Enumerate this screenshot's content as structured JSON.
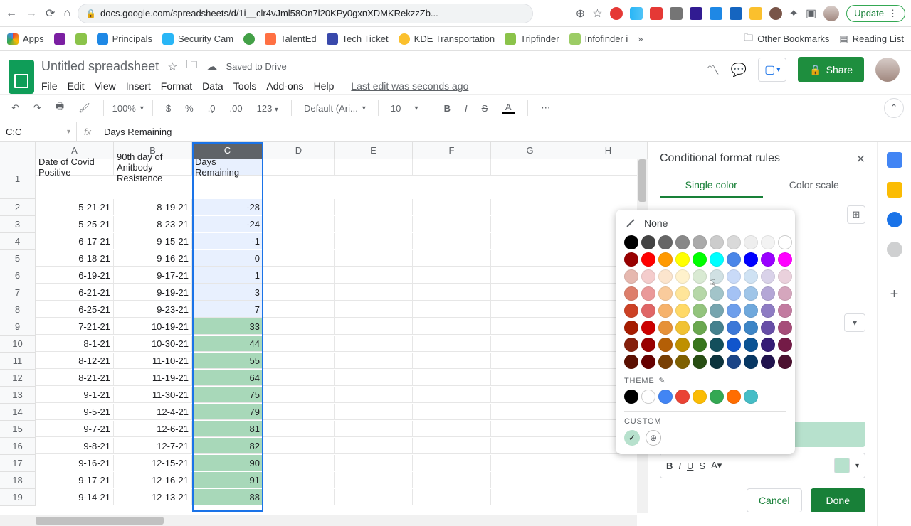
{
  "browser": {
    "url": "docs.google.com/spreadsheets/d/1i__clr4vJml58On7l20KPy0gxnXDMKRekzzZb...",
    "update": "Update",
    "bookmarks": [
      {
        "label": "Apps",
        "color": "#5f6368"
      },
      {
        "label": "",
        "color": "#7b1fa2"
      },
      {
        "label": "",
        "color": "#8bc34a"
      },
      {
        "label": "Principals",
        "color": "#1e88e5"
      },
      {
        "label": "Security Cam",
        "color": "#29b6f6"
      },
      {
        "label": "",
        "color": "#43a047"
      },
      {
        "label": "TalentEd",
        "color": "#ff7043"
      },
      {
        "label": "Tech Ticket",
        "color": "#3949ab"
      },
      {
        "label": "KDE Transportation",
        "color": "#fbc02d"
      },
      {
        "label": "Tripfinder",
        "color": "#8bc34a"
      },
      {
        "label": "Infofinder i",
        "color": "#9ccc65"
      }
    ],
    "right_bm": [
      {
        "label": "Other Bookmarks"
      },
      {
        "label": "Reading List"
      }
    ]
  },
  "docs": {
    "title": "Untitled spreadsheet",
    "saved": "Saved to Drive",
    "menus": [
      "File",
      "Edit",
      "View",
      "Insert",
      "Format",
      "Data",
      "Tools",
      "Add-ons",
      "Help"
    ],
    "last_edit": "Last edit was seconds ago",
    "share": "Share"
  },
  "toolbar": {
    "zoom": "100%",
    "font": "Default (Ari...",
    "size": "10"
  },
  "namebox": "C:C",
  "formula": "Days Remaining",
  "columns": [
    "A",
    "B",
    "C",
    "D",
    "E",
    "F",
    "G",
    "H"
  ],
  "rows": [
    {
      "n": 1,
      "a": "Date of Covid Positive",
      "b": "90th day of Anitbody Resistence",
      "c": "Days Remaining",
      "green": false,
      "header": true
    },
    {
      "n": 2,
      "a": "5-21-21",
      "b": "8-19-21",
      "c": "-28",
      "green": false
    },
    {
      "n": 3,
      "a": "5-25-21",
      "b": "8-23-21",
      "c": "-24",
      "green": false
    },
    {
      "n": 4,
      "a": "6-17-21",
      "b": "9-15-21",
      "c": "-1",
      "green": false
    },
    {
      "n": 5,
      "a": "6-18-21",
      "b": "9-16-21",
      "c": "0",
      "green": false
    },
    {
      "n": 6,
      "a": "6-19-21",
      "b": "9-17-21",
      "c": "1",
      "green": false
    },
    {
      "n": 7,
      "a": "6-21-21",
      "b": "9-19-21",
      "c": "3",
      "green": false
    },
    {
      "n": 8,
      "a": "6-25-21",
      "b": "9-23-21",
      "c": "7",
      "green": false
    },
    {
      "n": 9,
      "a": "7-21-21",
      "b": "10-19-21",
      "c": "33",
      "green": true
    },
    {
      "n": 10,
      "a": "8-1-21",
      "b": "10-30-21",
      "c": "44",
      "green": true
    },
    {
      "n": 11,
      "a": "8-12-21",
      "b": "11-10-21",
      "c": "55",
      "green": true
    },
    {
      "n": 12,
      "a": "8-21-21",
      "b": "11-19-21",
      "c": "64",
      "green": true
    },
    {
      "n": 13,
      "a": "9-1-21",
      "b": "11-30-21",
      "c": "75",
      "green": true
    },
    {
      "n": 14,
      "a": "9-5-21",
      "b": "12-4-21",
      "c": "79",
      "green": true
    },
    {
      "n": 15,
      "a": "9-7-21",
      "b": "12-6-21",
      "c": "81",
      "green": true
    },
    {
      "n": 16,
      "a": "9-8-21",
      "b": "12-7-21",
      "c": "82",
      "green": true
    },
    {
      "n": 17,
      "a": "9-16-21",
      "b": "12-15-21",
      "c": "90",
      "green": true
    },
    {
      "n": 18,
      "a": "9-17-21",
      "b": "12-16-21",
      "c": "91",
      "green": true
    },
    {
      "n": 19,
      "a": "9-14-21",
      "b": "12-13-21",
      "c": "88",
      "green": true
    }
  ],
  "pane": {
    "title": "Conditional format rules",
    "tab1": "Single color",
    "tab2": "Color scale",
    "cancel": "Cancel",
    "done": "Done"
  },
  "picker": {
    "none": "None",
    "theme": "THEME",
    "custom": "CUSTOM",
    "standard_rows": [
      [
        "#000000",
        "#434343",
        "#666666",
        "#888888",
        "#aaaaaa",
        "#cccccc",
        "#d9d9d9",
        "#eeeeee",
        "#f3f3f3",
        "#ffffff"
      ],
      [
        "#980000",
        "#ff0000",
        "#ff9900",
        "#ffff00",
        "#00ff00",
        "#00ffff",
        "#4a86e8",
        "#0000ff",
        "#9900ff",
        "#ff00ff"
      ],
      [
        "#e6b8af",
        "#f4cccc",
        "#fce5cd",
        "#fff2cc",
        "#d9ead3",
        "#d0e0e3",
        "#c9daf8",
        "#cfe2f3",
        "#d9d2e9",
        "#ead1dc"
      ],
      [
        "#dd7e6b",
        "#ea9999",
        "#f9cb9c",
        "#ffe599",
        "#b6d7a8",
        "#a2c4c9",
        "#a4c2f4",
        "#9fc5e8",
        "#b4a7d6",
        "#d5a6bd"
      ],
      [
        "#cc4125",
        "#e06666",
        "#f6b26b",
        "#ffd966",
        "#93c47d",
        "#76a5af",
        "#6d9eeb",
        "#6fa8dc",
        "#8e7cc3",
        "#c27ba0"
      ],
      [
        "#a61c00",
        "#cc0000",
        "#e69138",
        "#f1c232",
        "#6aa84f",
        "#45818e",
        "#3c78d8",
        "#3d85c6",
        "#674ea7",
        "#a64d79"
      ],
      [
        "#85200c",
        "#990000",
        "#b45f06",
        "#bf9000",
        "#38761d",
        "#134f5c",
        "#1155cc",
        "#0b5394",
        "#351c75",
        "#741b47"
      ],
      [
        "#5b0f00",
        "#660000",
        "#783f04",
        "#7f6000",
        "#274e13",
        "#0c343d",
        "#1c4587",
        "#073763",
        "#20124d",
        "#4c1130"
      ]
    ],
    "theme_row": [
      "#000000",
      "#ffffff",
      "#4285f4",
      "#ea4335",
      "#fbbc04",
      "#34a853",
      "#ff6d01",
      "#46bdc6"
    ]
  }
}
